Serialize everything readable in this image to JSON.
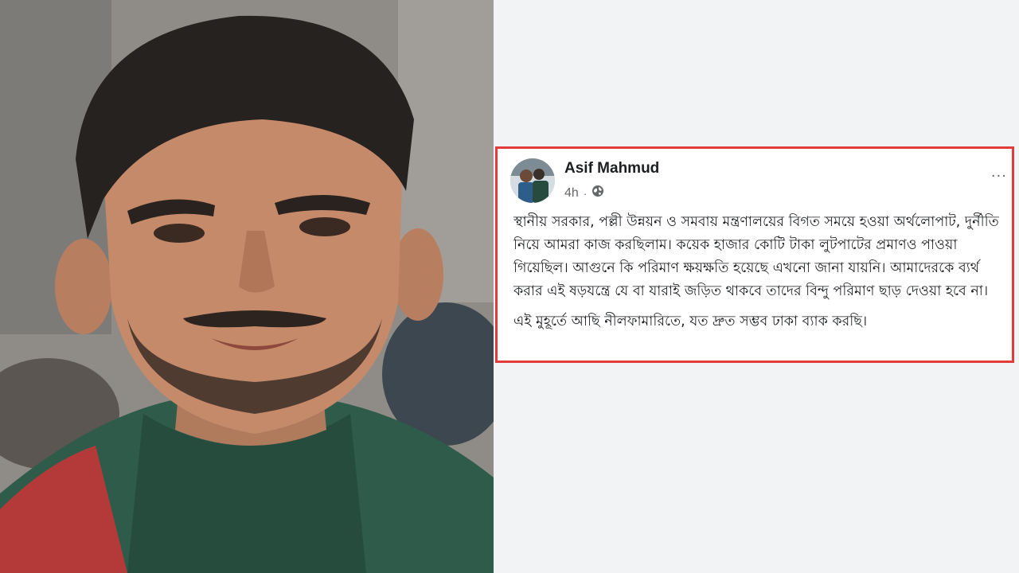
{
  "photo": {
    "alt": ""
  },
  "post": {
    "author_name": "Asif Mahmud",
    "time": "4h",
    "dot": "·",
    "privacy_icon": "globe-icon",
    "more_label": "···",
    "paragraph_1": "স্থানীয় সরকার, পল্লী উন্নয়ন ও সমবায় মন্ত্রণালয়ের বিগত সময়ে হওয়া অর্থলোপাট, দুর্নীতি নিয়ে আমরা কাজ করছিলাম। কয়েক হাজার কোটি টাকা লুটপাটের প্রমাণও পাওয়া গিয়েছিল। আগুনে কি পরিমাণ ক্ষয়ক্ষতি হয়েছে এখনো জানা যায়নি। আমাদেরকে ব্যর্থ করার এই ষড়যন্ত্রে যে বা যারাই জড়িত থাকবে তাদের বিন্দু পরিমাণ ছাড় দেওয়া হবে না।",
    "paragraph_2": "এই মুহূর্তে আছি নীলফামারিতে, যত দ্রুত সম্ভব ঢাকা ব্যাক করছি।"
  },
  "colors": {
    "highlight_border": "#e23b3b",
    "name_text": "#1c1e21",
    "meta_text": "#65676b"
  }
}
